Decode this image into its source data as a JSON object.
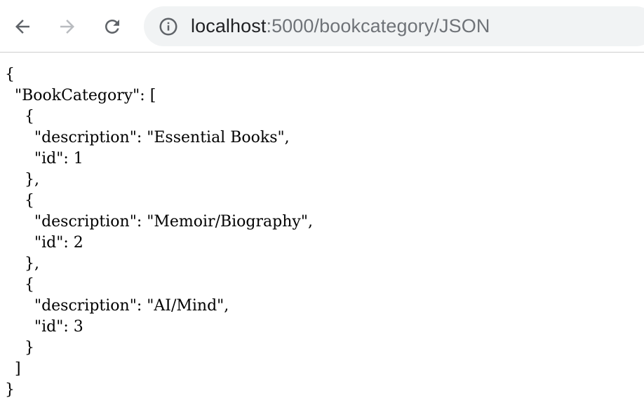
{
  "browser": {
    "url_host": "localhost",
    "url_rest": ":5000/bookcategory/JSON",
    "icons": {
      "back": "arrow-left-icon",
      "forward": "arrow-right-icon",
      "reload": "reload-icon",
      "site_info": "info-circle-icon"
    },
    "colors": {
      "omnibox_bg": "#f1f3f4",
      "url_host": "#202124",
      "url_rest": "#6f7378",
      "forward_disabled": "#b9bcc0"
    }
  },
  "json_lines": [
    "{",
    "  \"BookCategory\": [",
    "    {",
    "      \"description\": \"Essential Books\",",
    "      \"id\": 1",
    "    },",
    "    {",
    "      \"description\": \"Memoir/Biography\",",
    "      \"id\": 2",
    "    },",
    "    {",
    "      \"description\": \"AI/Mind\",",
    "      \"id\": 3",
    "    }",
    "  ]",
    "}"
  ]
}
